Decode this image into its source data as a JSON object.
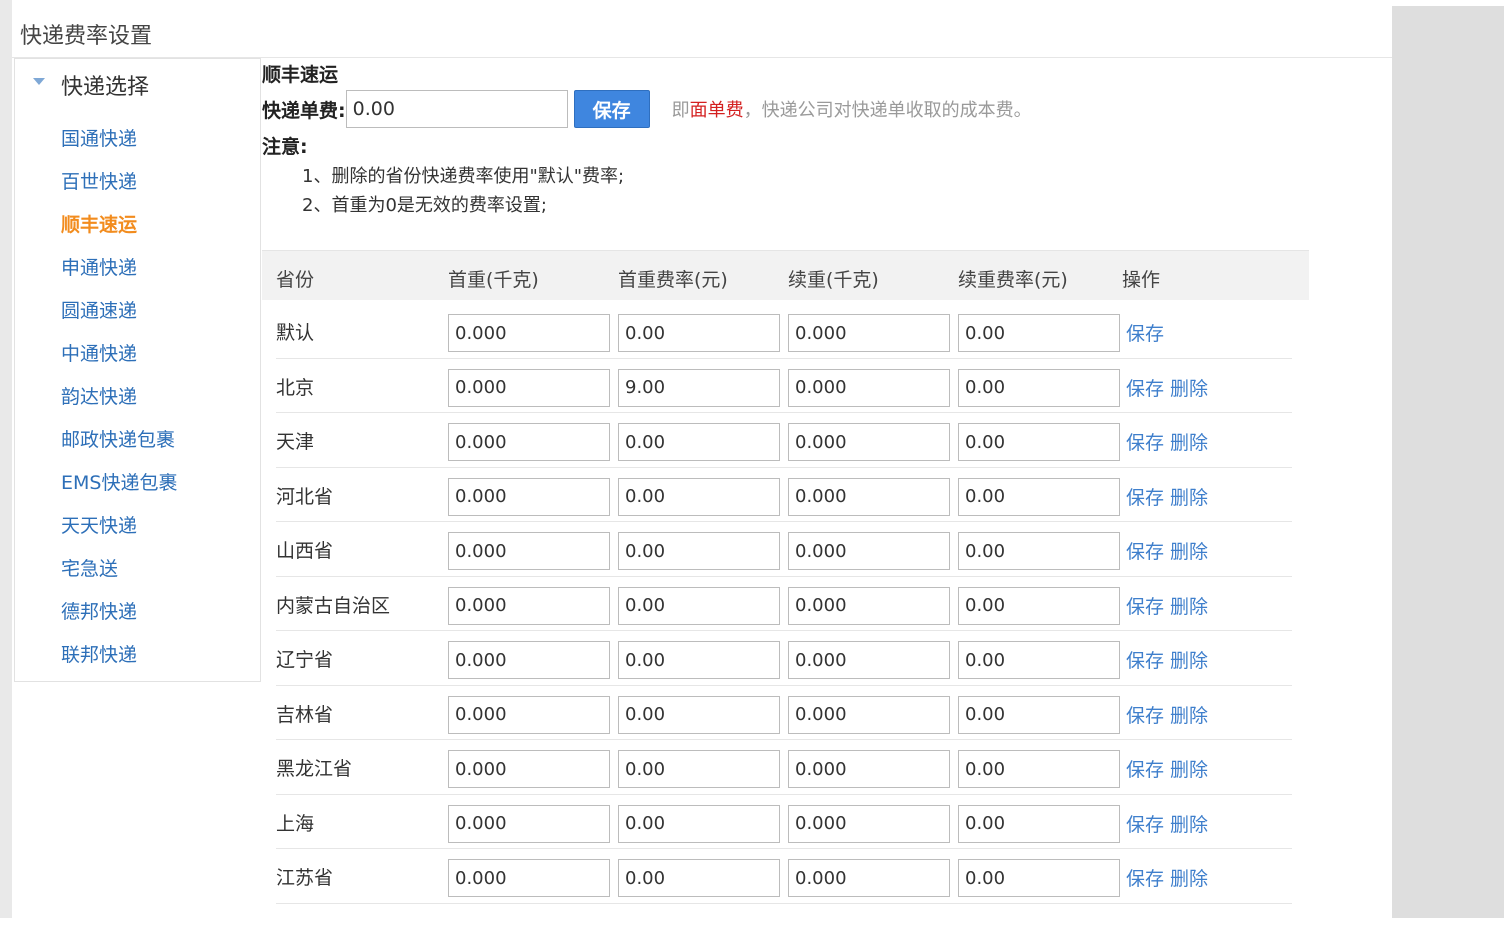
{
  "page_title": "快递费率设置",
  "sidebar": {
    "header": "快递选择",
    "items": [
      {
        "label": "国通快递",
        "active": false
      },
      {
        "label": "百世快递",
        "active": false
      },
      {
        "label": "顺丰速运",
        "active": true
      },
      {
        "label": "申通快递",
        "active": false
      },
      {
        "label": "圆通速递",
        "active": false
      },
      {
        "label": "中通快递",
        "active": false
      },
      {
        "label": "韵达快递",
        "active": false
      },
      {
        "label": "邮政快递包裹",
        "active": false
      },
      {
        "label": "EMS快递包裹",
        "active": false
      },
      {
        "label": "天天快递",
        "active": false
      },
      {
        "label": "宅急送",
        "active": false
      },
      {
        "label": "德邦快递",
        "active": false
      },
      {
        "label": "联邦快递",
        "active": false
      }
    ]
  },
  "carrier_title": "顺丰速运",
  "fee": {
    "label": "快递单费:",
    "value": "0.00",
    "save_label": "保存",
    "note_prefix": "即",
    "note_highlight": "面单费",
    "note_suffix": "，快递公司对快递单收取的成本费。"
  },
  "notice": {
    "label": "注意:",
    "line1": "1、删除的省份快递费率使用\"默认\"费率;",
    "line2": "2、首重为0是无效的费率设置;"
  },
  "table": {
    "headers": [
      "省份",
      "首重(千克)",
      "首重费率(元)",
      "续重(千克)",
      "续重费率(元)",
      "操作"
    ],
    "save_label": "保存",
    "delete_label": "删除",
    "rows": [
      {
        "province": "默认",
        "first_weight": "0.000",
        "first_rate": "0.00",
        "extra_weight": "0.000",
        "extra_rate": "0.00",
        "deletable": false
      },
      {
        "province": "北京",
        "first_weight": "0.000",
        "first_rate": "9.00",
        "extra_weight": "0.000",
        "extra_rate": "0.00",
        "deletable": true
      },
      {
        "province": "天津",
        "first_weight": "0.000",
        "first_rate": "0.00",
        "extra_weight": "0.000",
        "extra_rate": "0.00",
        "deletable": true
      },
      {
        "province": "河北省",
        "first_weight": "0.000",
        "first_rate": "0.00",
        "extra_weight": "0.000",
        "extra_rate": "0.00",
        "deletable": true
      },
      {
        "province": "山西省",
        "first_weight": "0.000",
        "first_rate": "0.00",
        "extra_weight": "0.000",
        "extra_rate": "0.00",
        "deletable": true
      },
      {
        "province": "内蒙古自治区",
        "first_weight": "0.000",
        "first_rate": "0.00",
        "extra_weight": "0.000",
        "extra_rate": "0.00",
        "deletable": true
      },
      {
        "province": "辽宁省",
        "first_weight": "0.000",
        "first_rate": "0.00",
        "extra_weight": "0.000",
        "extra_rate": "0.00",
        "deletable": true
      },
      {
        "province": "吉林省",
        "first_weight": "0.000",
        "first_rate": "0.00",
        "extra_weight": "0.000",
        "extra_rate": "0.00",
        "deletable": true
      },
      {
        "province": "黑龙江省",
        "first_weight": "0.000",
        "first_rate": "0.00",
        "extra_weight": "0.000",
        "extra_rate": "0.00",
        "deletable": true
      },
      {
        "province": "上海",
        "first_weight": "0.000",
        "first_rate": "0.00",
        "extra_weight": "0.000",
        "extra_rate": "0.00",
        "deletable": true
      },
      {
        "province": "江苏省",
        "first_weight": "0.000",
        "first_rate": "0.00",
        "extra_weight": "0.000",
        "extra_rate": "0.00",
        "deletable": true
      }
    ]
  }
}
